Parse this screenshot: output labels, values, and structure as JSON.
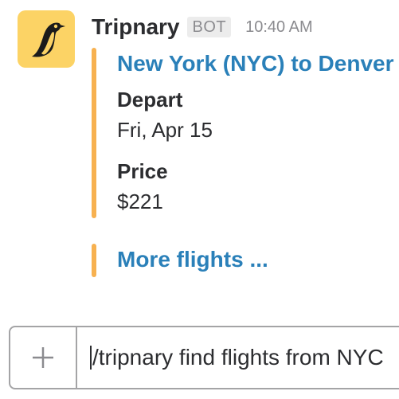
{
  "message": {
    "author": "Tripnary",
    "badge": "BOT",
    "timestamp": "10:40 AM",
    "avatar_icon": "penguin-icon",
    "attachments": [
      {
        "title": "New York (NYC) to Denver",
        "fields": [
          {
            "label": "Depart",
            "value": "Fri, Apr 15"
          },
          {
            "label": "Price",
            "value": "$221"
          }
        ]
      }
    ],
    "more_link": "More flights ..."
  },
  "composer": {
    "add_icon": "plus-icon",
    "input_value": "/tripnary find flights from NYC"
  },
  "colors": {
    "avatar_bg": "#fcd365",
    "attachment_bar": "#f7b150",
    "link": "#2a80b9"
  }
}
